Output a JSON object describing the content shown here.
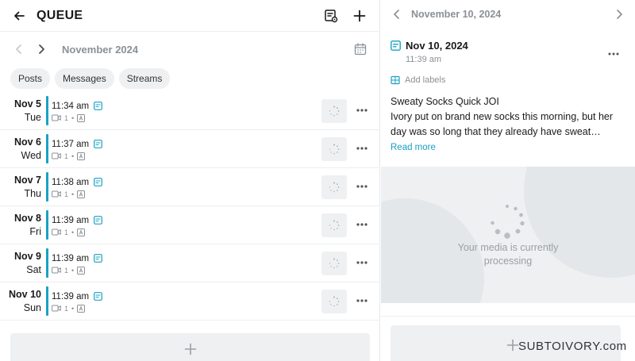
{
  "header": {
    "title": "QUEUE"
  },
  "month_nav": {
    "label": "November 2024"
  },
  "filters": [
    {
      "label": "Posts"
    },
    {
      "label": "Messages"
    },
    {
      "label": "Streams"
    }
  ],
  "queue": [
    {
      "day": "Nov 5",
      "weekday": "Tue",
      "time": "11:34 am",
      "media_count": "1"
    },
    {
      "day": "Nov 6",
      "weekday": "Wed",
      "time": "11:37 am",
      "media_count": "1"
    },
    {
      "day": "Nov 7",
      "weekday": "Thu",
      "time": "11:38 am",
      "media_count": "1"
    },
    {
      "day": "Nov 8",
      "weekday": "Fri",
      "time": "11:39 am",
      "media_count": "1"
    },
    {
      "day": "Nov 9",
      "weekday": "Sat",
      "time": "11:39 am",
      "media_count": "1"
    },
    {
      "day": "Nov 10",
      "weekday": "Sun",
      "time": "11:39 am",
      "media_count": "1"
    }
  ],
  "detail": {
    "nav_date": "November 10, 2024",
    "post_date": "Nov 10, 2024",
    "post_time": "11:39 am",
    "add_labels": "Add labels",
    "text_line1": "Sweaty Socks Quick JOI",
    "text_line2": "Ivory put on brand new socks this morning, but her day was so long that they already have sweat…",
    "read_more": "Read more",
    "media_status": "Your media is currently processing"
  },
  "watermark": "SUBTOIVORY.com",
  "colors": {
    "accent": "#1aa1c2",
    "muted": "#8a9096",
    "surface": "#eef0f2"
  }
}
